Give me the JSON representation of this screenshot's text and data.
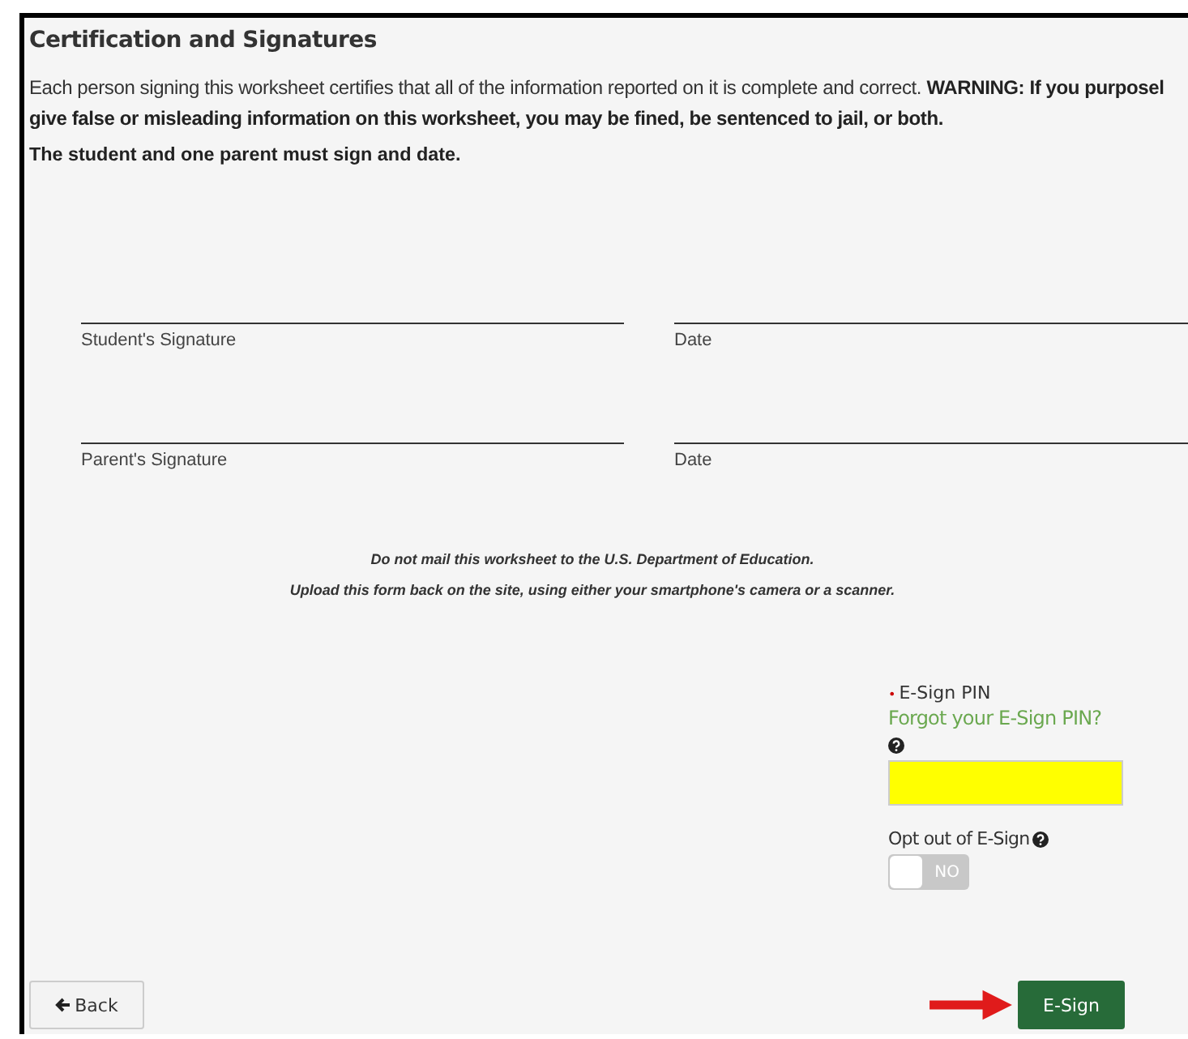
{
  "section": {
    "title": "Certification and Signatures",
    "statement_lines": [
      "Each person signing this worksheet certifies that all of the information reported on it is complete and correct. **WARNING: If you purposel**",
      "give false or misleading information on this worksheet, you may be fined, be sentenced to jail, or both."
    ],
    "requirement": "The student and one parent must sign and date."
  },
  "signature_rows": [
    {
      "signature_label": "Student's Signature",
      "date_label": "Date"
    },
    {
      "signature_label": "Parent's Signature",
      "date_label": "Date"
    }
  ],
  "notices": [
    "Do not mail this worksheet to the U.S. Department of Education.",
    "Upload this form back on the site, using either your smartphone's camera or a scanner."
  ],
  "esign": {
    "required_mark": "•",
    "pin_label": "E-Sign PIN",
    "forgot_link": "Forgot your E-Sign PIN?",
    "opt_out_label": "Opt out of E-Sign",
    "opt_out": {
      "on": false,
      "off_text": "NO"
    }
  },
  "buttons": {
    "back": "Back",
    "esign": "E-Sign"
  }
}
